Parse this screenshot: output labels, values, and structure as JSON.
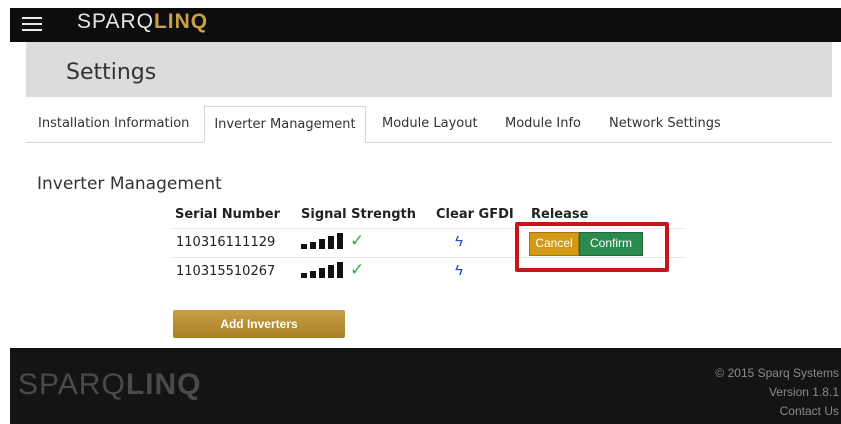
{
  "app": {
    "logo_prefix": "SPARQ",
    "logo_suffix": "LINQ"
  },
  "page": {
    "title": "Settings"
  },
  "tabs": [
    {
      "label": "Installation Information"
    },
    {
      "label": "Inverter Management"
    },
    {
      "label": "Module Layout"
    },
    {
      "label": "Module Info"
    },
    {
      "label": "Network Settings"
    }
  ],
  "active_tab": "Inverter Management",
  "section": {
    "title": "Inverter Management"
  },
  "table": {
    "columns": [
      "Serial Number",
      "Signal Strength",
      "Clear GFDI",
      "Release"
    ],
    "rows": [
      {
        "serial": "110316111129",
        "signal_bars": 5,
        "signal_ok": true
      },
      {
        "serial": "110315510267",
        "signal_bars": 5,
        "signal_ok": true
      }
    ]
  },
  "release": {
    "cancel_label": "Cancel",
    "confirm_label": "Confirm"
  },
  "add_inverters_label": "Add Inverters",
  "footer": {
    "copyright": "© 2015 Sparq Systems",
    "version": "Version 1.8.1",
    "contact": "Contact Us"
  },
  "icons": {
    "menu": "hamburger-menu-icon",
    "signal_ok": "check-icon",
    "clear_gfdi": "lightning-bolt-icon"
  },
  "colors": {
    "accent": "#c9a045",
    "cancel": "#d39a18",
    "confirm": "#2b8a4f",
    "highlight": "#c6161d",
    "bolt": "#1a47d4",
    "check": "#2bb24c"
  }
}
